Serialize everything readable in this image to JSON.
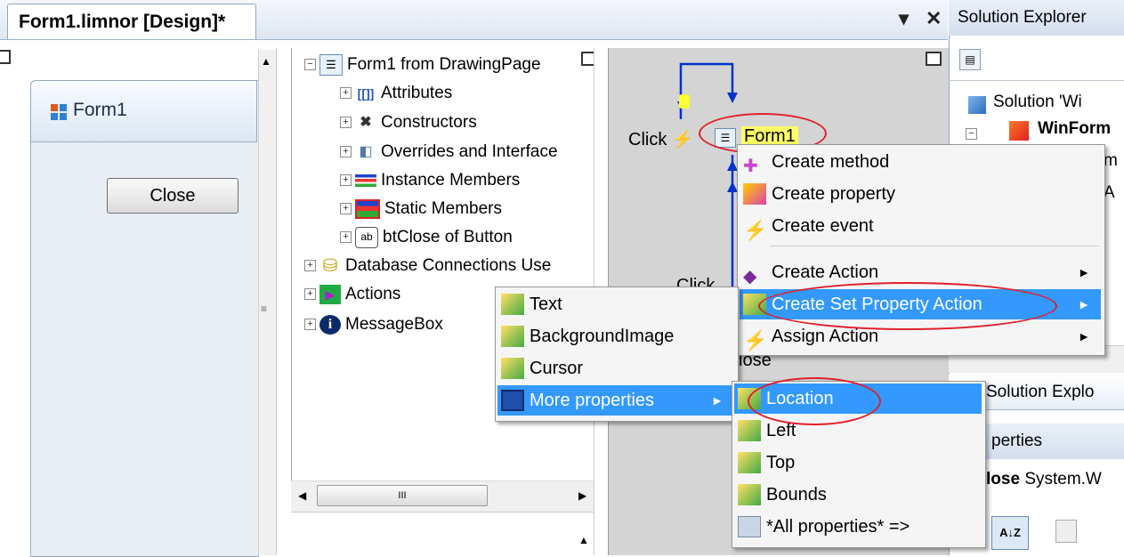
{
  "tab": {
    "title": "Form1.limnor [Design]*",
    "dropdown_glyph": "▾",
    "close_glyph": "✕"
  },
  "form": {
    "title": "Form1",
    "close_button": "Close"
  },
  "tree": {
    "root": "Form1 from DrawingPage",
    "children": [
      "Attributes",
      "Constructors",
      "Overrides and Interface",
      "Instance Members",
      "Static Members",
      "btClose of Button"
    ],
    "top_level": [
      "Database Connections Use",
      "Actions",
      "MessageBox"
    ],
    "scroll_thumb_glyph": "III",
    "btn_icon_text": "ab"
  },
  "canvas": {
    "click_label_1": "Click",
    "click_label_2": "Click",
    "form_node": "Form1",
    "lose_fragment": "lose"
  },
  "main_menu": {
    "items": [
      "Create method",
      "Create property",
      "Create event",
      "Create Action",
      "Create Set Property Action",
      "Assign Action"
    ],
    "arrow": "►"
  },
  "prop_menu": {
    "items": [
      "Text",
      "BackgroundImage",
      "Cursor",
      "More properties"
    ],
    "arrow": "►"
  },
  "more_menu": {
    "items": [
      "Location",
      "Left",
      "Top",
      "Bounds",
      "*All properties* =>"
    ]
  },
  "right_panel": {
    "header": "Solution Explorer",
    "solution": "Solution 'Wi",
    "project": "WinForm",
    "frag_m": "m",
    "frag_a": "A",
    "tab_label": "Solution Explo",
    "properties_header": "perties",
    "close_name": "lose",
    "close_type": "System.W",
    "sort_glyph": "A↓Z"
  },
  "colors": {
    "selection": "#3399ff",
    "highlight_oval": "#e0202a",
    "canvas": "#d4d4d4",
    "form_node": "#ffff66"
  }
}
